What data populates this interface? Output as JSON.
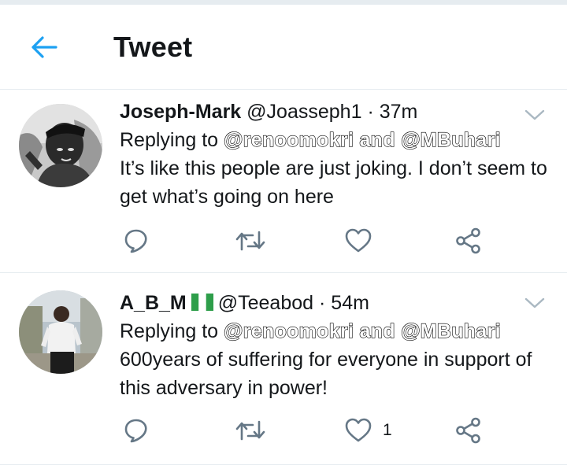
{
  "header": {
    "back_icon": "arrow-left-icon",
    "title": "Tweet"
  },
  "colors": {
    "accent": "#1da1f2",
    "icon_gray": "#657786",
    "divider": "#e6ecf0"
  },
  "tweets": [
    {
      "display_name": "Joseph-Mark",
      "handle": "@Joasseph1",
      "separator": "·",
      "time": "37m",
      "replying_label": "Replying to",
      "replying_mentions": "@renoomokri and @MBuhari",
      "text": "It’s like this people are just joking. I don’t seem to get what’s going on here",
      "like_count": ""
    },
    {
      "display_name": "A_B_M",
      "flag_icon": "nigeria-flag-icon",
      "handle": "@Teeabod",
      "separator": "·",
      "time": "54m",
      "replying_label": "Replying to",
      "replying_mentions": "@renoomokri and @MBuhari",
      "text": "600years of suffering for everyone in support of this adversary in power!",
      "like_count": "1"
    }
  ]
}
